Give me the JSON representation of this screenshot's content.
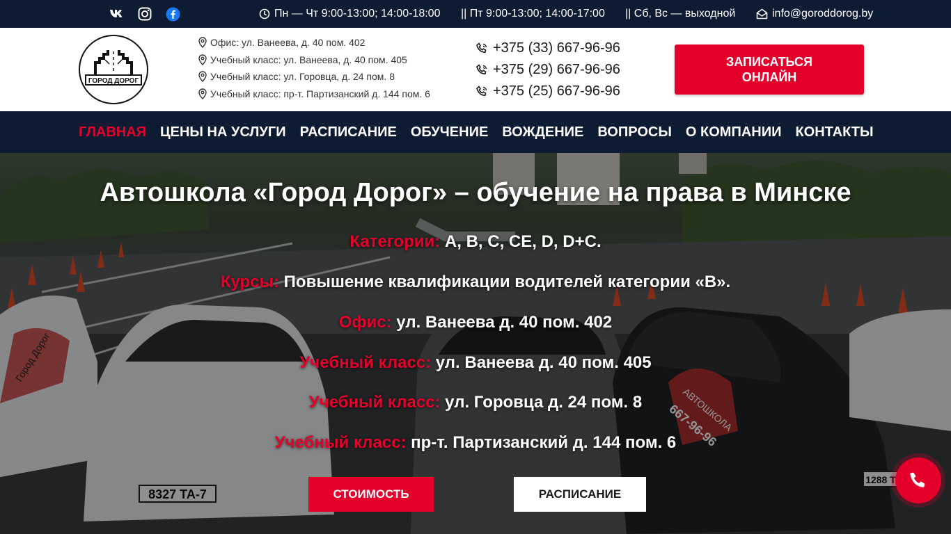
{
  "colors": {
    "navy": "#0d1b33",
    "accent": "#e4002b",
    "white": "#ffffff"
  },
  "topbar": {
    "socials": [
      {
        "name": "vk-icon",
        "glyph": "vk"
      },
      {
        "name": "instagram-icon",
        "glyph": "instagram"
      },
      {
        "name": "facebook-icon",
        "glyph": "facebook"
      }
    ],
    "hours_weekdays": "Пн — Чт 9:00-13:00; 14:00-18:00",
    "hours_friday": "|| Пт 9:00-13:00; 14:00-17:00",
    "hours_weekend": "|| Сб, Вс — выходной",
    "email": "info@goroddorog.by"
  },
  "header": {
    "logo_text": "ГОРОД ДОРОГ",
    "addresses": [
      "Офис: ул. Ванеева, д. 40 пом. 402",
      "Учебный класс: ул. Ванеева, д. 40 пом. 405",
      "Учебный класс: ул. Горовца, д. 24 пом. 8",
      "Учебный класс: пр-т. Партизанский д. 144 пом. 6"
    ],
    "phones": [
      "+375 (33) 667-96-96",
      "+375 (29) 667-96-96",
      "+375 (25) 667-96-96"
    ],
    "cta_label": "ЗАПИСАТЬСЯ\nОНЛАЙН"
  },
  "nav": {
    "items": [
      "ГЛАВНАЯ",
      "ЦЕНЫ НА УСЛУГИ",
      "РАСПИСАНИЕ",
      "ОБУЧЕНИЕ",
      "ВОЖДЕНИЕ",
      "ВОПРОСЫ",
      "О КОМПАНИИ",
      "КОНТАКТЫ"
    ],
    "active_index": 0
  },
  "hero": {
    "title": "Автошкола «Город Дорог» – обучение на права в Минске",
    "lines": [
      {
        "label": "Категории:",
        "value": " A, B, C, CE, D, D+C."
      },
      {
        "label": "Курсы:",
        "value": " Повышение квалификации водителей категории «B»."
      },
      {
        "label": "Офис:",
        "value": " ул. Ванеева д. 40 пом. 402"
      },
      {
        "label": "Учебный класс:",
        "value": " ул. Ванеева д. 40 пом. 405"
      },
      {
        "label": "Учебный класс:",
        "value": " ул. Горовца д. 24 пом. 8"
      },
      {
        "label": "Учебный класс:",
        "value": " пр-т. Партизанский д. 144 пом. 6"
      }
    ],
    "btn_cost": "СТОИМОСТЬ",
    "btn_schedule": "РАСПИСАНИЕ",
    "plate_left": "8327 TA-7",
    "plate_right": "1288 T",
    "car_text_1": "Город Дорог",
    "car_text_2": "АВТОШКОЛА",
    "car_text_3": "667-96-96"
  }
}
